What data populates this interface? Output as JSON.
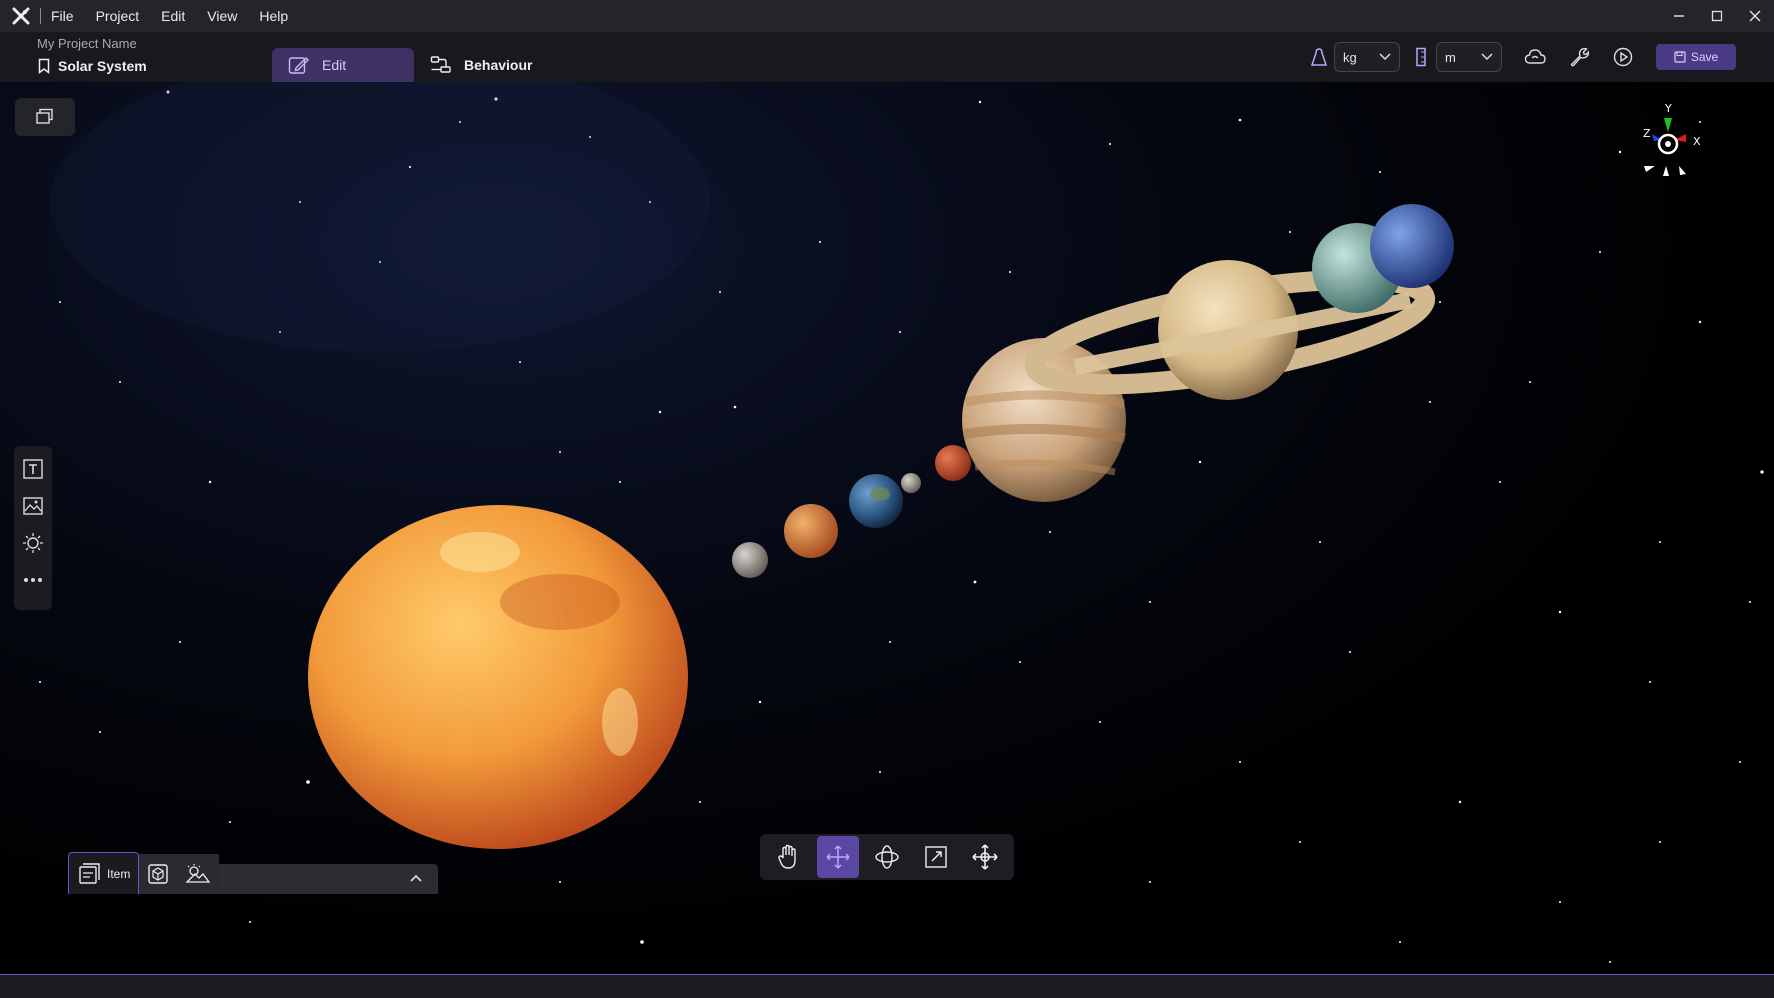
{
  "menu": {
    "file": "File",
    "project": "Project",
    "edit": "Edit",
    "view": "View",
    "help": "Help"
  },
  "header": {
    "project_name": "My Project Name",
    "scene_name": "Solar System",
    "tabs": [
      {
        "label": "Edit"
      },
      {
        "label": "Behaviour"
      }
    ],
    "mass_unit": "kg",
    "length_unit": "m",
    "save_label": "Save"
  },
  "gizmo": {
    "x": "X",
    "y": "Y",
    "z": "Z"
  },
  "panel": {
    "item_label": "Item"
  },
  "colors": {
    "accent": "#5b48a2",
    "accent_dark": "#3e3163",
    "panel": "#1b1b21",
    "titlebar": "#24242b"
  },
  "planets": [
    "Sun",
    "Mercury",
    "Venus",
    "Earth",
    "Moon",
    "Mars",
    "Jupiter",
    "Saturn",
    "Uranus",
    "Neptune"
  ]
}
